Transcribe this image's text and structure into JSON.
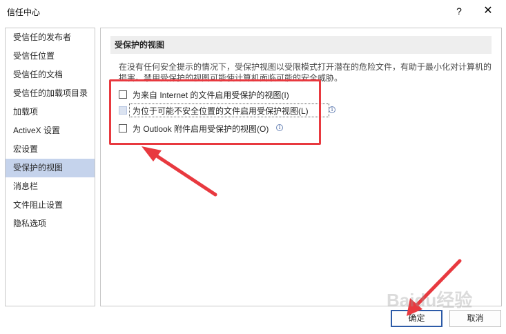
{
  "window": {
    "title": "信任中心",
    "help": "?",
    "close": "✕"
  },
  "sidebar": {
    "items": [
      {
        "label": "受信任的发布者"
      },
      {
        "label": "受信任位置"
      },
      {
        "label": "受信任的文档"
      },
      {
        "label": "受信任的加载项目录"
      },
      {
        "label": "加载项"
      },
      {
        "label": "ActiveX 设置"
      },
      {
        "label": "宏设置"
      },
      {
        "label": "受保护的视图",
        "selected": true
      },
      {
        "label": "消息栏"
      },
      {
        "label": "文件阻止设置"
      },
      {
        "label": "隐私选项"
      }
    ]
  },
  "main": {
    "section_title": "受保护的视图",
    "description": "在没有任何安全提示的情况下，受保护视图以受限模式打开潜在的危险文件，有助于最小化对计算机的损害。禁用受保护的视图可能使计算机面临可能的安全威胁。",
    "options": [
      {
        "label": "为来自 Internet 的文件启用受保护的视图(I)",
        "checked": false,
        "info": false
      },
      {
        "label": "为位于可能不安全位置的文件启用受保护视图(L)",
        "checked": false,
        "info": true
      },
      {
        "label": "为 Outlook 附件启用受保护的视图(O)",
        "checked": false,
        "info": true
      }
    ]
  },
  "footer": {
    "ok_label": "确定",
    "cancel_label": "取消"
  },
  "annotation": {
    "color": "#e8393f"
  },
  "watermark": "Baidu经验"
}
